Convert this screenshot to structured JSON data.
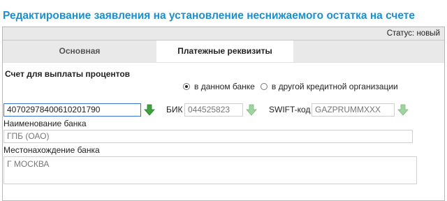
{
  "page": {
    "title": "Редактирование заявления на установление неснижаемого остатка на счете"
  },
  "status": {
    "text": "Статус: новый"
  },
  "tabs": [
    {
      "label": "Основная",
      "active": false
    },
    {
      "label": "Платежные реквизиты",
      "active": true
    }
  ],
  "form": {
    "section_title": "Счет для выплаты процентов",
    "bank_choice": {
      "options": [
        "в данном банке",
        "в другой кредитной организации"
      ],
      "selected": "в данном банке"
    },
    "account": {
      "value": "40702978400610201790"
    },
    "bik": {
      "label": "БИК",
      "value": "044525823"
    },
    "swift": {
      "label": "SWIFT-код",
      "value": "GAZPRUMMXXX"
    },
    "bank_name": {
      "label": "Наименование банка",
      "value": "ГПБ (ОАО)"
    },
    "bank_location": {
      "label": "Местонахождение банка",
      "value": "Г МОСКВА"
    }
  },
  "colors": {
    "title": "#1c8fcf",
    "arrow_active": "#3da23d",
    "arrow_inactive": "#9fd39f"
  },
  "icons": {
    "select_arrow": "arrow-down-icon"
  }
}
